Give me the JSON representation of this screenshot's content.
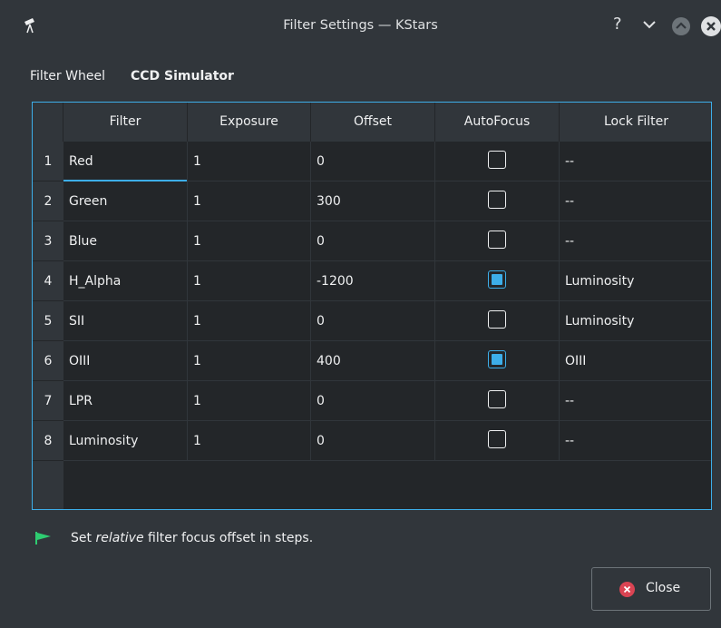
{
  "window": {
    "title": "Filter Settings — KStars",
    "help_glyph": "?"
  },
  "filter_wheel": {
    "label": "Filter Wheel",
    "value": "CCD Simulator"
  },
  "table": {
    "headers": [
      "Filter",
      "Exposure",
      "Offset",
      "AutoFocus",
      "Lock Filter"
    ],
    "rows": [
      {
        "num": "1",
        "filter": "Red",
        "exposure": "1",
        "offset": "0",
        "autofocus": false,
        "lock": "--"
      },
      {
        "num": "2",
        "filter": "Green",
        "exposure": "1",
        "offset": "300",
        "autofocus": false,
        "lock": "--"
      },
      {
        "num": "3",
        "filter": "Blue",
        "exposure": "1",
        "offset": "0",
        "autofocus": false,
        "lock": "--"
      },
      {
        "num": "4",
        "filter": "H_Alpha",
        "exposure": "1",
        "offset": "-1200",
        "autofocus": true,
        "lock": "Luminosity"
      },
      {
        "num": "5",
        "filter": "SII",
        "exposure": "1",
        "offset": "0",
        "autofocus": false,
        "lock": "Luminosity"
      },
      {
        "num": "6",
        "filter": "OIII",
        "exposure": "1",
        "offset": "400",
        "autofocus": true,
        "lock": "OIII"
      },
      {
        "num": "7",
        "filter": "LPR",
        "exposure": "1",
        "offset": "0",
        "autofocus": false,
        "lock": "--"
      },
      {
        "num": "8",
        "filter": "Luminosity",
        "exposure": "1",
        "offset": "0",
        "autofocus": false,
        "lock": "--"
      }
    ]
  },
  "hint": {
    "prefix": "Set ",
    "emphasis": "relative",
    "suffix": " filter focus offset in steps."
  },
  "buttons": {
    "close_label": "Close"
  },
  "colors": {
    "accent": "#3daee9",
    "background": "#31363b",
    "table_bg": "#232629",
    "flag": "#2ecc71",
    "close_icon": "#da4453"
  },
  "icons": [
    "telescope-icon",
    "help-icon",
    "minimize-icon",
    "maximize-icon",
    "close-window-icon",
    "flag-icon",
    "close-icon"
  ]
}
